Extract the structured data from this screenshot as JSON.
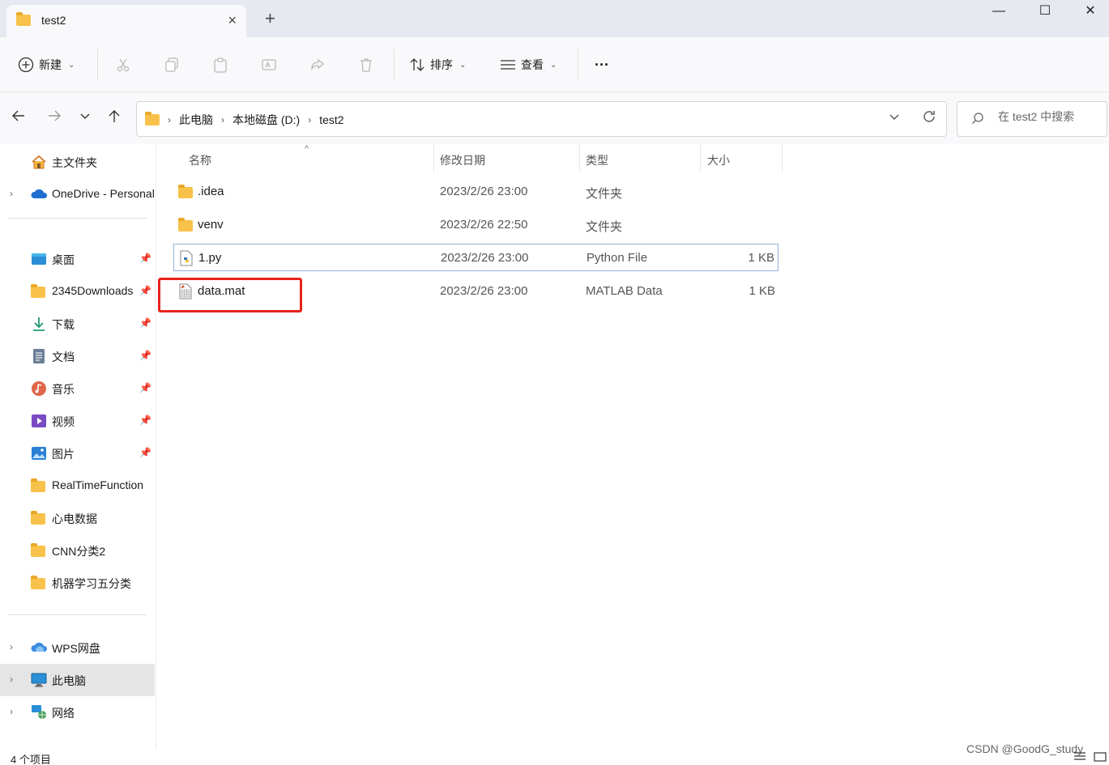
{
  "window": {
    "tab_title": "test2",
    "close_tab": "×",
    "new_tab": "+",
    "minimize": "—",
    "maximize": "☐",
    "close": "✕"
  },
  "commandbar": {
    "new_label": "新建",
    "sort_label": "排序",
    "view_label": "查看",
    "more_label": "···"
  },
  "nav": {
    "breadcrumbs": [
      "此电脑",
      "本地磁盘 (D:)",
      "test2"
    ],
    "search_placeholder": "在 test2 中搜索"
  },
  "sidebar": {
    "items": [
      {
        "label": "主文件夹",
        "icon": "home-icon"
      },
      {
        "label": "OneDrive - Personal",
        "icon": "onedrive-icon"
      },
      {
        "label": "桌面",
        "icon": "desktop-icon"
      },
      {
        "label": "2345Downloads",
        "icon": "folder-icon"
      },
      {
        "label": "下载",
        "icon": "download-icon"
      },
      {
        "label": "文档",
        "icon": "document-icon"
      },
      {
        "label": "音乐",
        "icon": "music-icon"
      },
      {
        "label": "视频",
        "icon": "video-icon"
      },
      {
        "label": "图片",
        "icon": "picture-icon"
      },
      {
        "label": "RealTimeFunction",
        "icon": "folder-icon"
      },
      {
        "label": "心电数据",
        "icon": "folder-icon"
      },
      {
        "label": "CNN分类2",
        "icon": "folder-icon"
      },
      {
        "label": "机器学习五分类",
        "icon": "folder-icon"
      },
      {
        "label": "WPS网盘",
        "icon": "cloud-icon"
      },
      {
        "label": "此电脑",
        "icon": "computer-icon"
      },
      {
        "label": "网络",
        "icon": "network-icon"
      }
    ]
  },
  "filelist": {
    "columns": {
      "name": "名称",
      "modified": "修改日期",
      "type": "类型",
      "size": "大小"
    },
    "rows": [
      {
        "name": ".idea",
        "modified": "2023/2/26 23:00",
        "type": "文件夹",
        "size": ""
      },
      {
        "name": "venv",
        "modified": "2023/2/26 22:50",
        "type": "文件夹",
        "size": ""
      },
      {
        "name": "1.py",
        "modified": "2023/2/26 23:00",
        "type": "Python File",
        "size": "1 KB"
      },
      {
        "name": "data.mat",
        "modified": "2023/2/26 23:00",
        "type": "MATLAB Data",
        "size": "1 KB"
      }
    ]
  },
  "status": {
    "item_count": "4 个项目",
    "watermark": "CSDN @GoodG_study"
  },
  "colors": {
    "highlight_box": "#e8231c",
    "selected_row_border": "#8fb3d9",
    "folder": "#f8c24a"
  }
}
